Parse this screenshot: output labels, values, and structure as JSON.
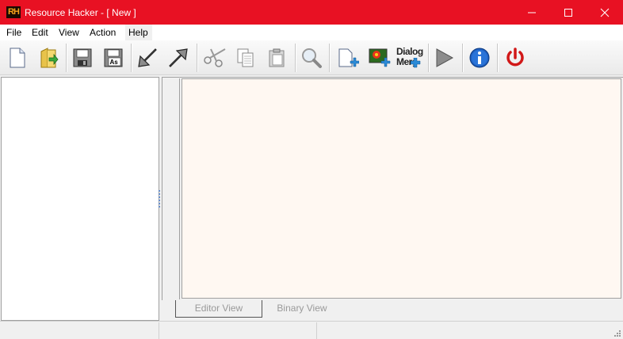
{
  "window": {
    "app_icon_text": "RH",
    "title": "Resource Hacker - [ New ]",
    "accent_color": "#e81123"
  },
  "menu": {
    "items": [
      {
        "label": "File"
      },
      {
        "label": "Edit"
      },
      {
        "label": "View"
      },
      {
        "label": "Action"
      },
      {
        "label": "Help"
      }
    ]
  },
  "toolbar": {
    "buttons": [
      {
        "icon": "new-file-icon"
      },
      {
        "icon": "open-folder-icon"
      },
      {
        "icon": "save-icon"
      },
      {
        "icon": "save-as-icon",
        "label": "As"
      },
      {
        "icon": "compile-arrow-icon"
      },
      {
        "icon": "export-arrow-icon"
      },
      {
        "icon": "cut-icon"
      },
      {
        "icon": "copy-icon"
      },
      {
        "icon": "paste-icon"
      },
      {
        "icon": "find-icon"
      },
      {
        "icon": "add-blank-resource-icon"
      },
      {
        "icon": "add-image-resource-icon"
      },
      {
        "icon": "dialog-merger-icon",
        "label_line1": "Dialog",
        "label_line2": "Merger"
      },
      {
        "icon": "run-script-icon"
      },
      {
        "icon": "info-icon"
      },
      {
        "icon": "power-icon"
      }
    ]
  },
  "editor": {
    "background_color": "#fff8f2",
    "tabs": [
      {
        "label": "Editor View",
        "active": true
      },
      {
        "label": "Binary View",
        "active": false
      }
    ]
  },
  "statusbar": {
    "cells": [
      "",
      "",
      ""
    ]
  }
}
